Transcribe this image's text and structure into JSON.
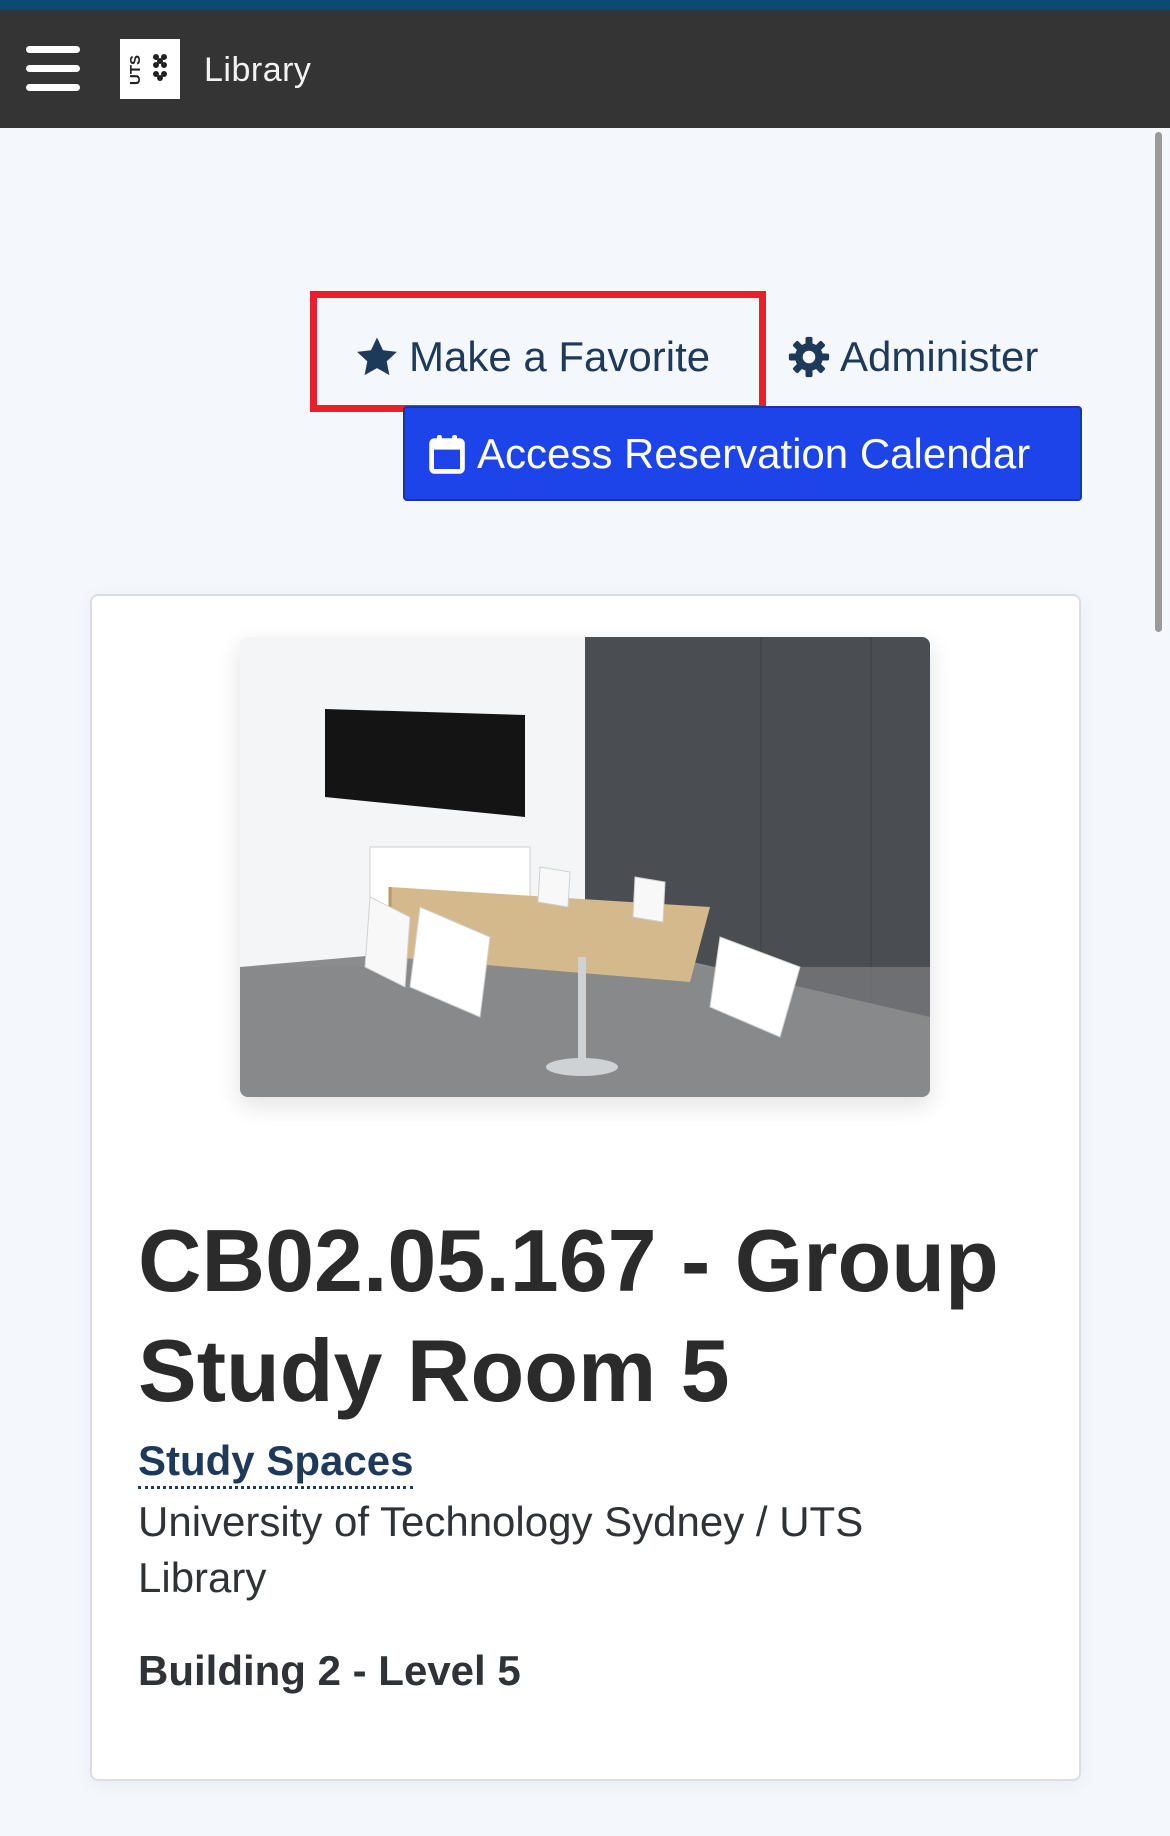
{
  "navbar": {
    "menu_icon": "hamburger-menu-icon",
    "logo_text": "UTS",
    "brand": "Library",
    "background": "#343434",
    "accent": "#0b4a73"
  },
  "actions": {
    "favorite": {
      "label": "Make a Favorite",
      "icon": "star-icon"
    },
    "administer": {
      "label": "Administer",
      "icon": "gear-icon"
    },
    "calendar": {
      "label": "Access Reservation Calendar",
      "icon": "calendar-icon",
      "color": "#1c44e8"
    },
    "highlight_color": "#e8202a"
  },
  "room": {
    "photo": "group-study-room-photo",
    "title": "CB02.05.167 - Group Study Room 5",
    "category": "Study Spaces",
    "location": "University of Technology Sydney / UTS Library",
    "building": "Building 2 - Level 5"
  }
}
